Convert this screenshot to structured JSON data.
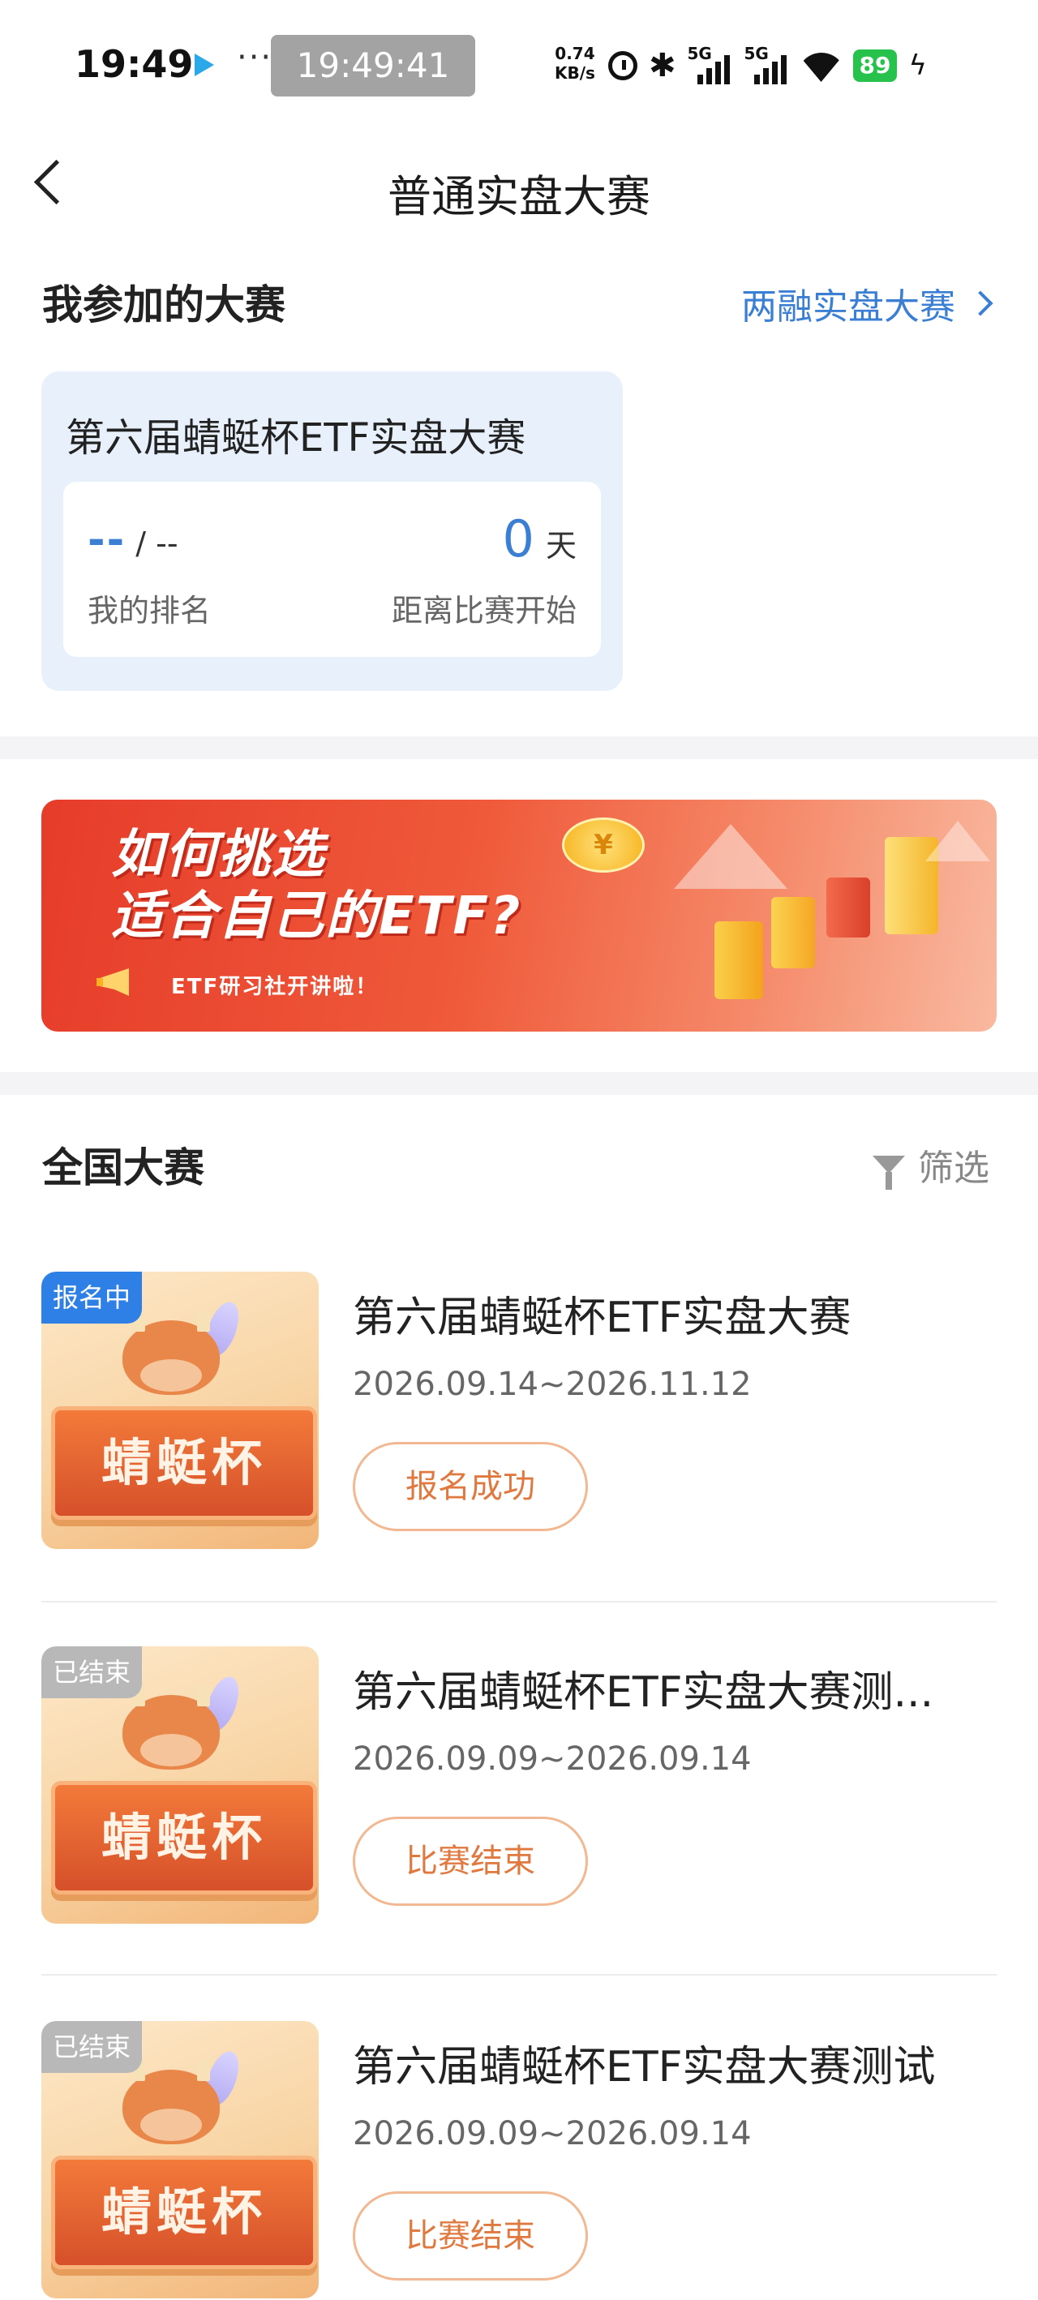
{
  "status_bar": {
    "time": "19:49",
    "clock_pill": "19:49:41",
    "dots": "···",
    "net_speed_value": "0.74",
    "net_speed_unit": "KB/s",
    "signal1": "5G",
    "signal2": "5G",
    "battery": "89",
    "icons": [
      "play-store-icon",
      "alarm-icon",
      "bluetooth-icon",
      "signal-icon",
      "wifi-icon",
      "battery-icon",
      "charging-icon"
    ]
  },
  "header": {
    "title": "普通实盘大赛"
  },
  "my_contests": {
    "section_title": "我参加的大赛",
    "link": "两融实盘大赛",
    "card": {
      "name": "第六届蜻蜓杯ETF实盘大赛",
      "rank_value": "--",
      "rank_total": "/ --",
      "rank_label": "我的排名",
      "days_value": "0",
      "days_unit": "天",
      "days_label": "距离比赛开始"
    }
  },
  "banner": {
    "line1": "如何挑选",
    "line2": "适合自己的ETF?",
    "sub": "ETF研习社开讲啦！",
    "coin": "¥"
  },
  "national": {
    "section_title": "全国大赛",
    "filter_label": "筛选",
    "items": [
      {
        "badge": "报名中",
        "thumb_text": "蜻蜓杯",
        "name": "第六届蜻蜓杯ETF实盘大赛",
        "date": "2026.09.14~2026.11.12",
        "button": "报名成功"
      },
      {
        "badge": "已结束",
        "thumb_text": "蜻蜓杯",
        "name": "第六届蜻蜓杯ETF实盘大赛测...",
        "date": "2026.09.09~2026.09.14",
        "button": "比赛结束"
      },
      {
        "badge": "已结束",
        "thumb_text": "蜻蜓杯",
        "name": "第六届蜻蜓杯ETF实盘大赛测试",
        "date": "2026.09.09~2026.09.14",
        "button": "比赛结束"
      }
    ]
  },
  "colors": {
    "accent_blue": "#3b7fd4",
    "badge_active": "#2f80e6",
    "badge_ended": "#b8b8b8",
    "button_text": "#e0793f"
  }
}
